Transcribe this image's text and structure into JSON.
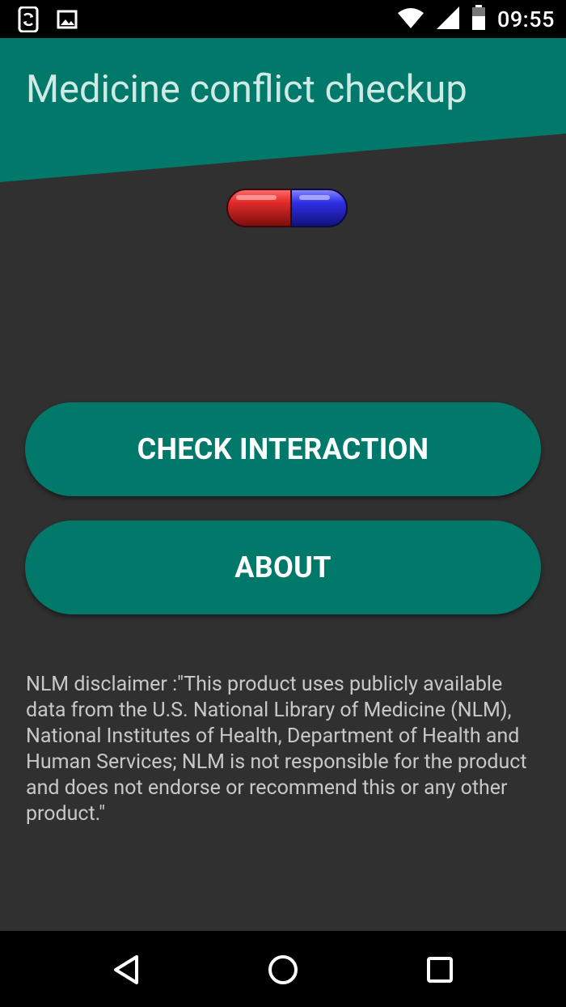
{
  "status_bar": {
    "time": "09:55",
    "icons": [
      "screen-rotation-icon",
      "image-icon",
      "wifi-icon",
      "signal-icon",
      "battery-icon"
    ]
  },
  "header": {
    "title": "Medicine conflict checkup",
    "color": "#00796b"
  },
  "buttons": {
    "check_interaction": "CHECK INTERACTION",
    "about": "ABOUT"
  },
  "disclaimer": "NLM disclaimer :\"This product uses publicly available data from the U.S. National Library of Medicine (NLM), National Institutes of Health, Department of Health and Human Services; NLM is not responsible for the product and does not endorse or recommend this or any other product.\"",
  "nav_bar": {
    "icons": [
      "back-icon",
      "home-icon",
      "recents-icon"
    ]
  },
  "colors": {
    "background": "#303030",
    "accent": "#00796b",
    "pill_red": "#d32f2f",
    "pill_blue": "#2b2bd8"
  }
}
